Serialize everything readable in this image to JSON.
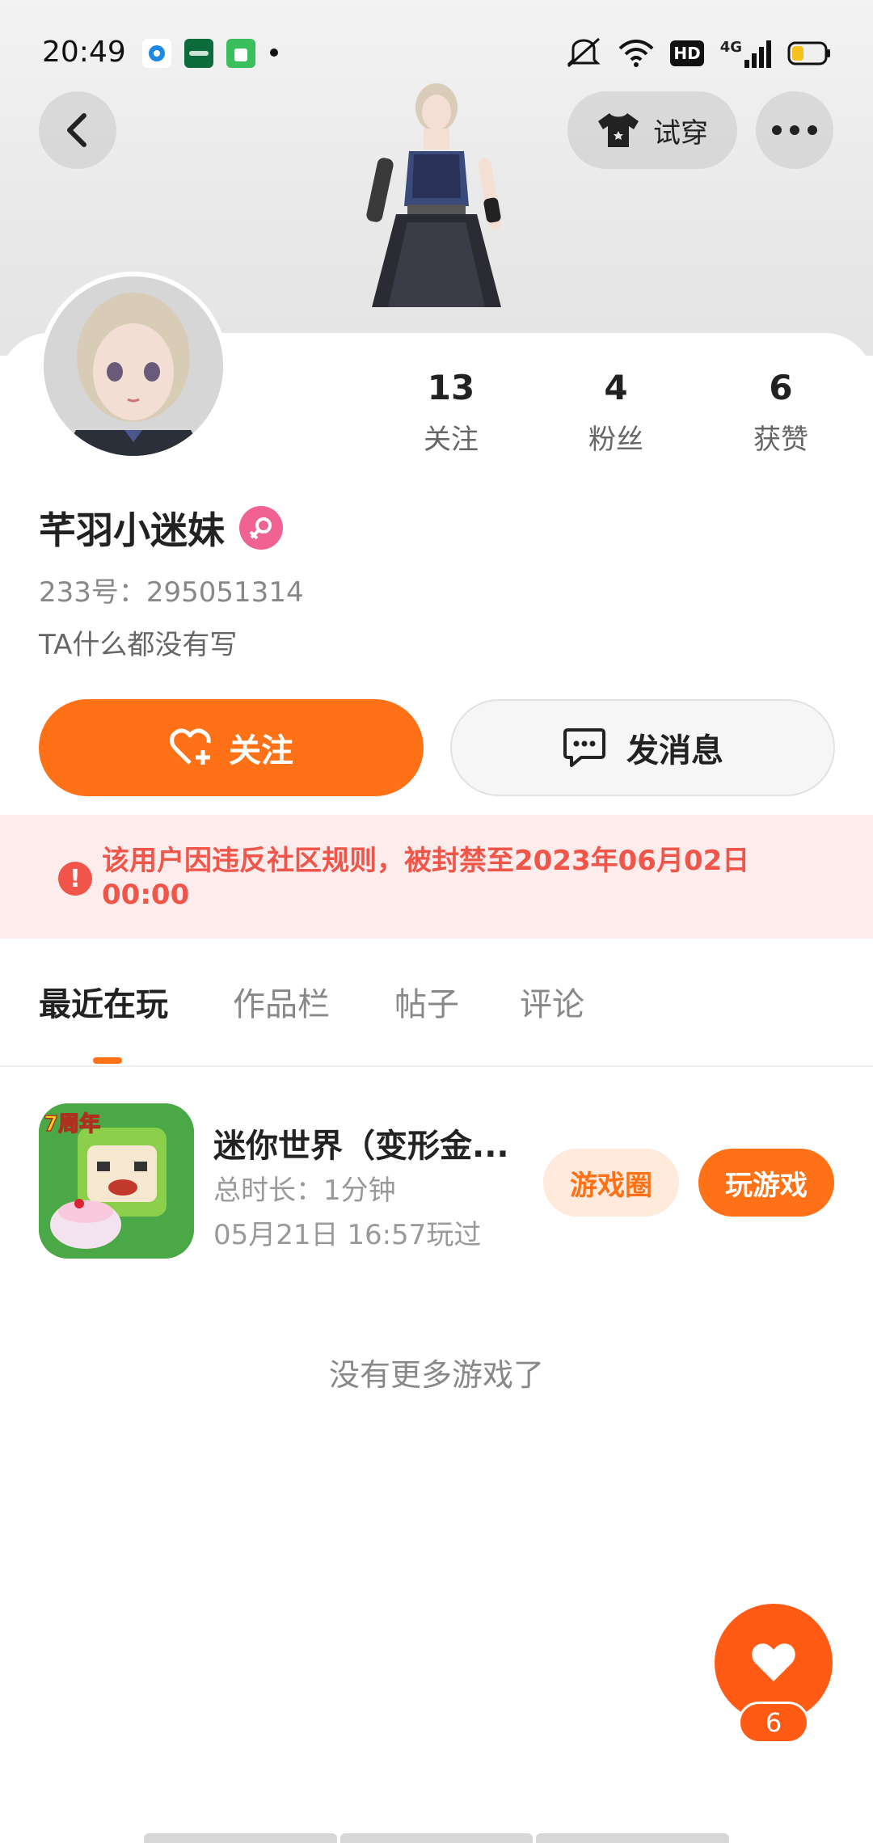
{
  "status_bar": {
    "time": "20:49",
    "apps": [
      "location-app",
      "oppo-app",
      "market-app"
    ],
    "network_label": "4G",
    "hd_label": "HD"
  },
  "header": {
    "tryon_label": "试穿",
    "back_icon": "chevron-left-icon",
    "more_icon": "more-dots-icon"
  },
  "profile": {
    "nickname": "芊羽小迷妹",
    "uid": "233号：295051314",
    "bio": "TA什么都没有写",
    "gender": "female"
  },
  "stats": [
    {
      "value": "13",
      "label": "关注"
    },
    {
      "value": "4",
      "label": "粉丝"
    },
    {
      "value": "6",
      "label": "获赞"
    }
  ],
  "actions": {
    "follow_label": "关注",
    "message_label": "发消息"
  },
  "ban_notice": {
    "text": "该用户因违反社区规则，被封禁至2023年06月02日 00:00",
    "icon": "!"
  },
  "tabs": [
    {
      "label": "最近在玩",
      "active": true
    },
    {
      "label": "作品栏",
      "active": false
    },
    {
      "label": "帖子",
      "active": false
    },
    {
      "label": "评论",
      "active": false
    }
  ],
  "games": [
    {
      "title": "迷你世界（变形金...",
      "duration": "总时长：1分钟",
      "last_played": "05月21日 16:57玩过",
      "circle_label": "游戏圈",
      "play_label": "玩游戏",
      "icon_badge": "7周年"
    }
  ],
  "empty_text": "没有更多游戏了",
  "like": {
    "count": "6"
  },
  "colors": {
    "accent": "#ff7116",
    "like": "#ff5b14",
    "ban_text": "#f0554a",
    "ban_bg": "#fdecec"
  }
}
